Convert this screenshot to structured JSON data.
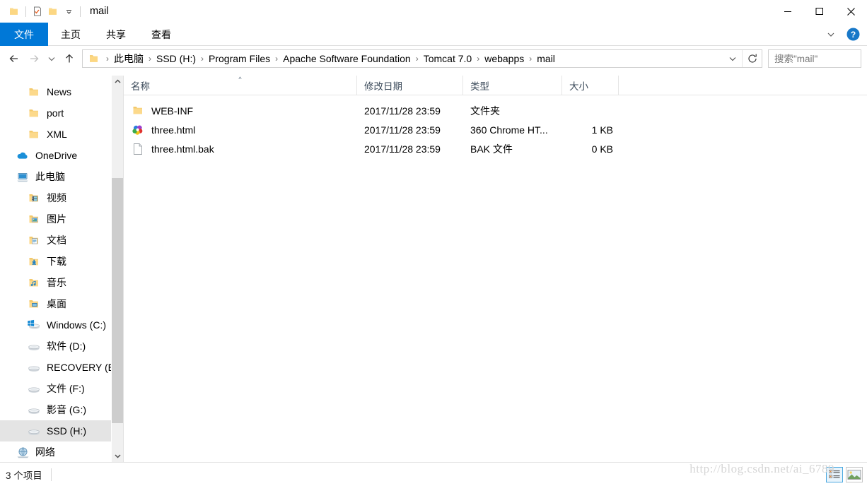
{
  "window": {
    "title": "mail",
    "quick_access": [
      {
        "name": "folder-icon",
        "label": "folder"
      },
      {
        "name": "properties-icon",
        "label": "properties"
      },
      {
        "name": "new-folder-icon",
        "label": "new folder"
      },
      {
        "name": "chevron-down-icon",
        "label": "customize"
      }
    ],
    "controls": {
      "minimize": "—",
      "maximize": "□",
      "close": "✕"
    }
  },
  "ribbon": {
    "tabs": [
      {
        "label": "文件",
        "active": true
      },
      {
        "label": "主页",
        "active": false
      },
      {
        "label": "共享",
        "active": false
      },
      {
        "label": "查看",
        "active": false
      }
    ],
    "collapse_icon": "chevron-down-icon",
    "help_label": "?"
  },
  "addressbar": {
    "back_icon": "arrow-left-icon",
    "forward_icon": "arrow-right-icon",
    "recent_icon": "chevron-down-icon",
    "up_icon": "arrow-up-icon",
    "breadcrumbs": [
      "此电脑",
      "SSD (H:)",
      "Program Files",
      "Apache Software Foundation",
      "Tomcat 7.0",
      "webapps",
      "mail"
    ],
    "separator": "›",
    "dropdown_icon": "chevron-down-icon",
    "refresh_icon": "refresh-icon"
  },
  "search": {
    "placeholder": "搜索\"mail\"",
    "value": "",
    "icon": "search-icon"
  },
  "sidebar": {
    "items": [
      {
        "label": "News",
        "icon": "folder-icon",
        "indent": 1,
        "selected": false
      },
      {
        "label": "port",
        "icon": "folder-icon",
        "indent": 1,
        "selected": false
      },
      {
        "label": "XML",
        "icon": "folder-icon",
        "indent": 1,
        "selected": false
      },
      {
        "label": "OneDrive",
        "icon": "cloud-icon",
        "indent": 0,
        "selected": false
      },
      {
        "label": "此电脑",
        "icon": "computer-icon",
        "indent": 0,
        "selected": false
      },
      {
        "label": "视频",
        "icon": "videos-folder-icon",
        "indent": 1,
        "selected": false
      },
      {
        "label": "图片",
        "icon": "pictures-folder-icon",
        "indent": 1,
        "selected": false
      },
      {
        "label": "文档",
        "icon": "documents-folder-icon",
        "indent": 1,
        "selected": false
      },
      {
        "label": "下载",
        "icon": "downloads-folder-icon",
        "indent": 1,
        "selected": false
      },
      {
        "label": "音乐",
        "icon": "music-folder-icon",
        "indent": 1,
        "selected": false
      },
      {
        "label": "桌面",
        "icon": "desktop-folder-icon",
        "indent": 1,
        "selected": false
      },
      {
        "label": "Windows (C:)",
        "icon": "windows-drive-icon",
        "indent": 1,
        "selected": false
      },
      {
        "label": "软件 (D:)",
        "icon": "drive-icon",
        "indent": 1,
        "selected": false
      },
      {
        "label": "RECOVERY (E:)",
        "icon": "drive-icon",
        "indent": 1,
        "selected": false
      },
      {
        "label": "文件 (F:)",
        "icon": "drive-icon",
        "indent": 1,
        "selected": false
      },
      {
        "label": "影音 (G:)",
        "icon": "drive-icon",
        "indent": 1,
        "selected": false
      },
      {
        "label": "SSD (H:)",
        "icon": "drive-icon",
        "indent": 1,
        "selected": true
      },
      {
        "label": "网络",
        "icon": "network-icon",
        "indent": 0,
        "selected": false
      }
    ],
    "scroll_up_icon": "chevron-up-icon",
    "scroll_down_icon": "chevron-down-icon"
  },
  "filelist": {
    "columns": [
      {
        "label": "名称",
        "key": "name",
        "sorted": "asc"
      },
      {
        "label": "修改日期",
        "key": "date"
      },
      {
        "label": "类型",
        "key": "type"
      },
      {
        "label": "大小",
        "key": "size"
      }
    ],
    "rows": [
      {
        "name": "WEB-INF",
        "date": "2017/11/28 23:59",
        "type": "文件夹",
        "size": "",
        "icon": "folder-icon"
      },
      {
        "name": "three.html",
        "date": "2017/11/28 23:59",
        "type": "360 Chrome HT...",
        "size": "1 KB",
        "icon": "chrome360-file-icon"
      },
      {
        "name": "three.html.bak",
        "date": "2017/11/28 23:59",
        "type": "BAK 文件",
        "size": "0 KB",
        "icon": "generic-file-icon"
      }
    ]
  },
  "statusbar": {
    "item_count": "3 个项目",
    "views": [
      {
        "name": "details-view-button",
        "active": true
      },
      {
        "name": "large-icons-view-button",
        "active": false
      }
    ]
  },
  "watermark": "http://blog.csdn.net/ai_6789",
  "colors": {
    "accent": "#0078d7",
    "selection": "#e4e4e4",
    "header_text": "#3b4a5a",
    "folder_yellow": "#ffd277"
  }
}
